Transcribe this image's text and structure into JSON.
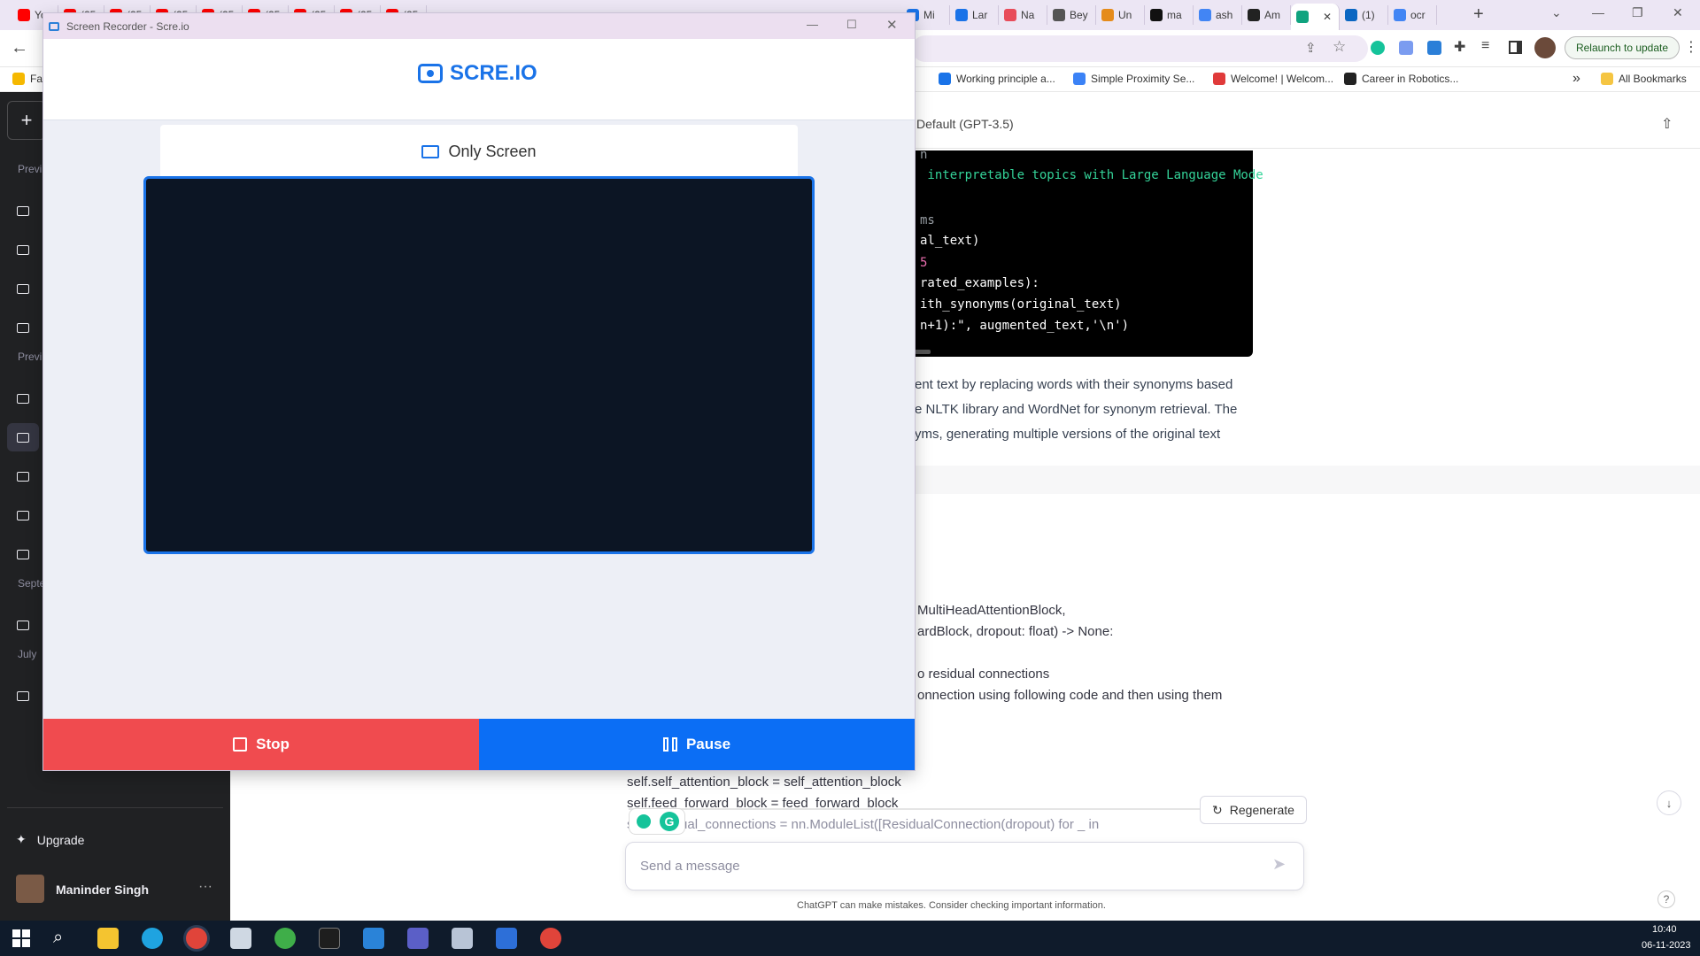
{
  "browser": {
    "tabs": [
      {
        "label": "Yo",
        "color": "#ff0000"
      },
      {
        "label": "(25",
        "color": "#ff0000"
      },
      {
        "label": "(25",
        "color": "#ff0000"
      },
      {
        "label": "(25",
        "color": "#ff0000"
      },
      {
        "label": "(25",
        "color": "#ff0000"
      },
      {
        "label": "(25",
        "color": "#ff0000"
      },
      {
        "label": "(25",
        "color": "#ff0000"
      },
      {
        "label": "(25",
        "color": "#ff0000"
      },
      {
        "label": "(25",
        "color": "#ff0000"
      },
      {
        "label": "Mi",
        "color": "#1a73e8"
      },
      {
        "label": "Lar",
        "color": "#1a73e8"
      },
      {
        "label": "Na",
        "color": "#e84c5a"
      },
      {
        "label": "Bey",
        "color": "#555555"
      },
      {
        "label": "Un",
        "color": "#e58b1a"
      },
      {
        "label": "ma",
        "color": "#111111"
      },
      {
        "label": "ash",
        "color": "#4285f4"
      },
      {
        "label": "Am",
        "color": "#222222"
      },
      {
        "label": "",
        "color": "#10a37f"
      },
      {
        "label": "(1)",
        "color": "#0a66c2"
      },
      {
        "label": "ocr",
        "color": "#4285f4"
      }
    ],
    "new_tab": "+",
    "relaunch": "Relaunch to update",
    "bookmarks": [
      {
        "label": "Working principle a...",
        "color": "#1a73e8"
      },
      {
        "label": "Simple Proximity Se...",
        "color": "#3b82f6"
      },
      {
        "label": "Welcome! | Welcom...",
        "color": "#e03a3a"
      },
      {
        "label": "Career in Robotics...",
        "color": "#222222"
      }
    ],
    "bookmarks_more": "»",
    "all_bookmarks": "All Bookmarks",
    "bookmarks_left": "Fa"
  },
  "sidebar": {
    "new_chat": "+",
    "sections": [
      "Previ",
      "Previ",
      "Septe",
      "July"
    ],
    "upgrade": "Upgrade",
    "user_name": "Maninder Singh",
    "more": "···"
  },
  "chat": {
    "model": "Default (GPT-3.5)",
    "code_lines": [
      {
        "text": "n",
        "color": "#9aa0a6"
      },
      {
        "text": " interpretable topics with Large Language Mode",
        "color": "#34d399"
      },
      {
        "text": "",
        "color": "#ffffff"
      },
      {
        "text": "ms",
        "color": "#9aa0a6"
      },
      {
        "text": "al_text)",
        "color": "#ffffff"
      },
      {
        "text": "5",
        "color": "#f472b6"
      },
      {
        "text": "rated_examples):",
        "color": "#ffffff"
      },
      {
        "text": "ith_synonyms(original_text)",
        "color": "#ffffff"
      },
      {
        "text": "n+1):\", augmented_text,'\\n')",
        "color": "#ffffff"
      }
    ],
    "explain_lines": [
      "ent text by replacing words with their synonyms based",
      "e NLTK library and WordNet for synonym retrieval. The",
      "yms, generating multiple versions of the original text"
    ],
    "user_lines": [
      "MultiHeadAttentionBlock,",
      "ardBlock, dropout: float) -> None:",
      "",
      "o residual connections",
      "onnection using following code and then using them"
    ],
    "input_lines": [
      "self.self_attention_block = self_attention_block",
      "self.feed_forward_block = feed_forward_block",
      "self.residual_connections = nn.ModuleList([ResidualConnection(dropout) for _ in"
    ],
    "regenerate": "Regenerate",
    "message_placeholder": "Send a message",
    "disclaimer": "ChatGPT can make mistakes. Consider checking important information.",
    "help": "?"
  },
  "recorder": {
    "window_title": "Screen Recorder - Scre.io",
    "logo_text": "SCRE.IO",
    "mode_label": "Only Screen",
    "stop_label": "Stop",
    "pause_label": "Pause",
    "colors": {
      "stop": "#f04b4f",
      "pause": "#0b6ef5",
      "accent": "#1a73e8"
    }
  },
  "taskbar": {
    "time": "10:40",
    "date": "06-11-2023"
  }
}
